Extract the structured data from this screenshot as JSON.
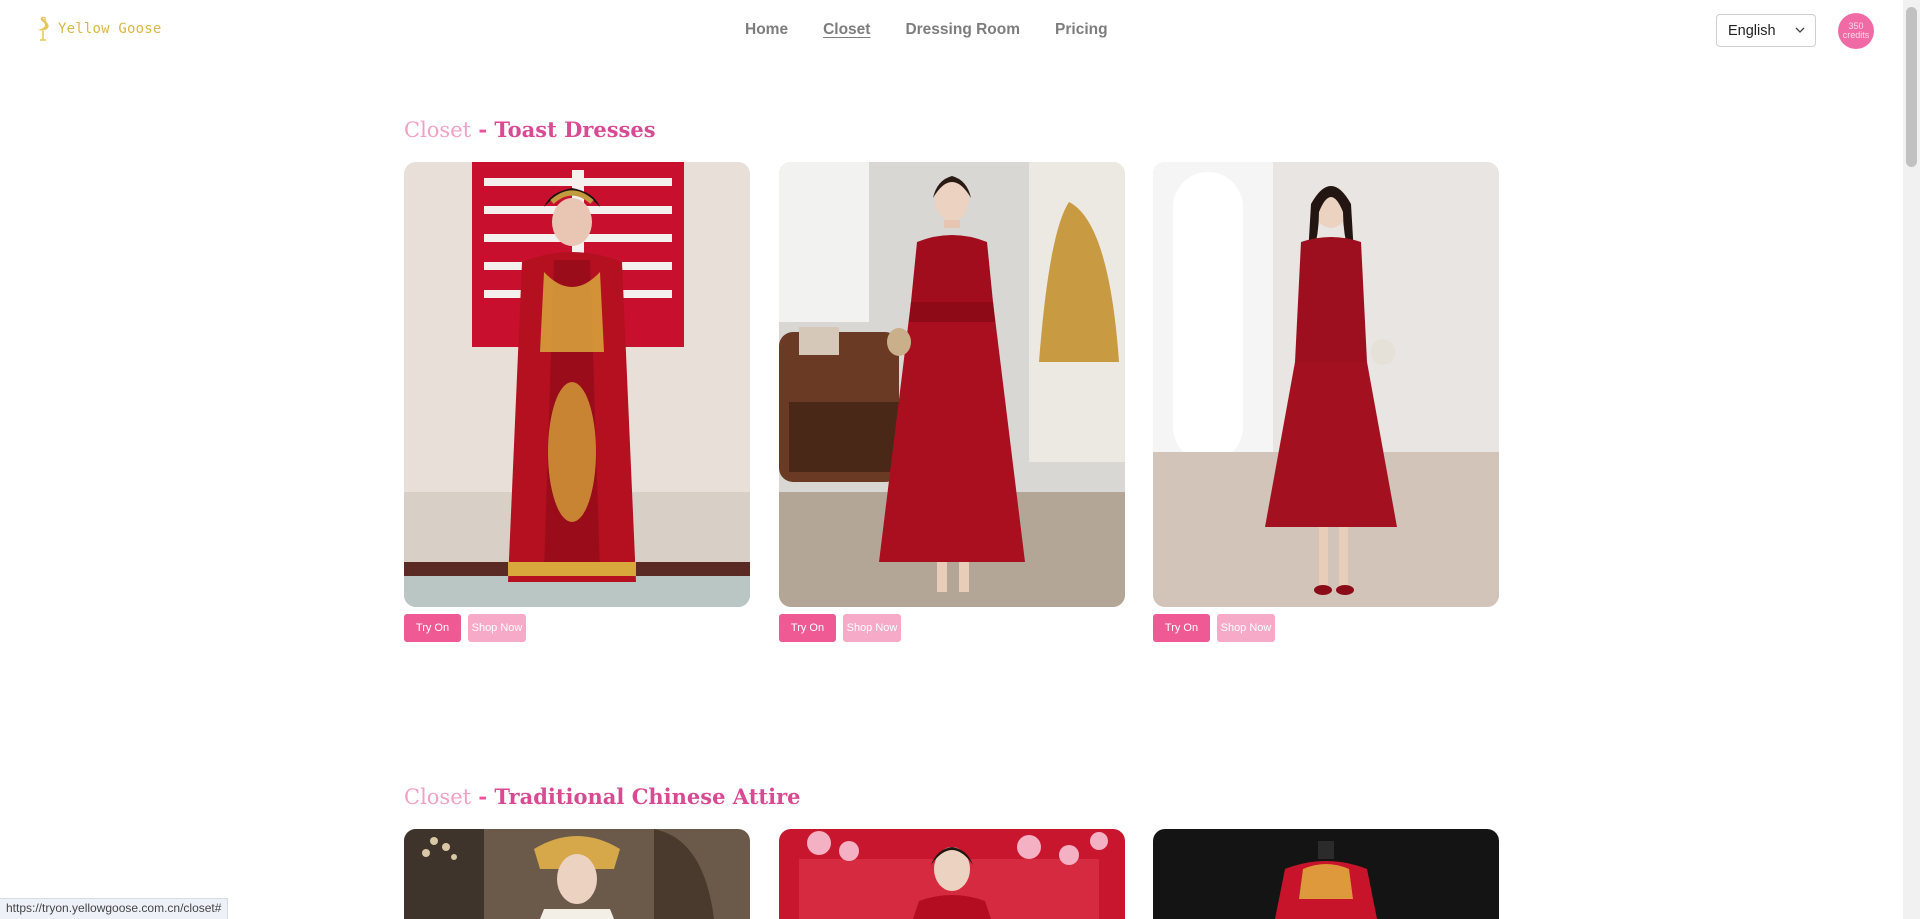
{
  "brand": {
    "name": "Yellow Goose",
    "logo_icon": "goose-icon",
    "color": "#d8b84a"
  },
  "nav": {
    "items": [
      {
        "label": "Home",
        "active": false
      },
      {
        "label": "Closet",
        "active": true
      },
      {
        "label": "Dressing Room",
        "active": false
      },
      {
        "label": "Pricing",
        "active": false
      }
    ]
  },
  "language": {
    "selected": "English"
  },
  "account": {
    "credits_line1": "350",
    "credits_line2": "credits"
  },
  "colors": {
    "accent": "#ef5a95",
    "accent_light": "#f7a9c8",
    "title": "#d94a93"
  },
  "sections": [
    {
      "prefix": "Closet",
      "separator": " - ",
      "name": "Toast Dresses",
      "cards": [
        {
          "image": "red-embroidered-xiuhe-gown",
          "try_on": "Try On",
          "shop_now": "Shop Now"
        },
        {
          "image": "red-puff-sleeve-maxi-dress",
          "try_on": "Try On",
          "shop_now": "Shop Now"
        },
        {
          "image": "red-square-neck-midi-dress",
          "try_on": "Try On",
          "shop_now": "Shop Now"
        }
      ]
    },
    {
      "prefix": "Closet",
      "separator": " - ",
      "name": "Traditional Chinese Attire",
      "cards": [
        {
          "image": "bride-gold-headdress"
        },
        {
          "image": "bride-red-floral-backdrop"
        },
        {
          "image": "red-jacket-on-mannequin"
        }
      ]
    }
  ],
  "status_bar": {
    "url": "https://tryon.yellowgoose.com.cn/closet#"
  }
}
